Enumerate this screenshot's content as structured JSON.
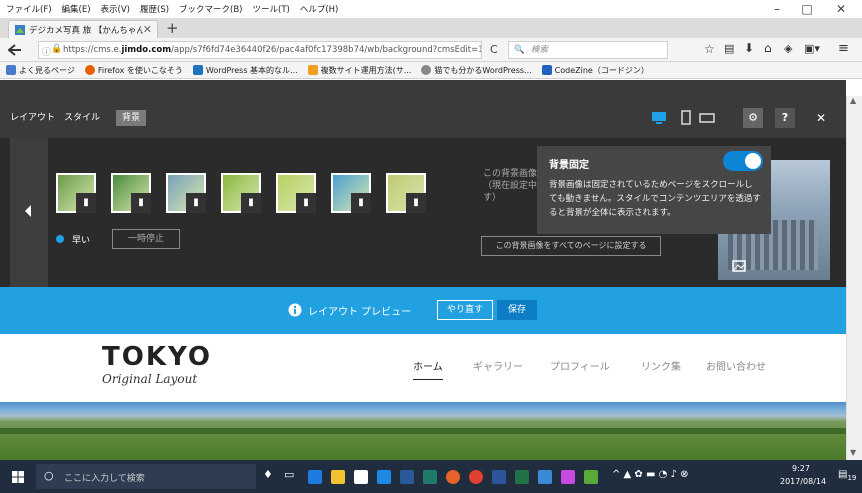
{
  "browser": {
    "menu": [
      "ファイル(F)",
      "編集(E)",
      "表示(V)",
      "履歴(S)",
      "ブックマーク(B)",
      "ツール(T)",
      "ヘルプ(H)"
    ],
    "window_controls": {
      "minimize": "–",
      "maximize": "□",
      "close": "✕"
    },
    "tab": {
      "title": "デジカメ写真 旅 【かんちゃん",
      "close": "✕"
    },
    "new_tab": "+",
    "url_host": "https://cms.e.",
    "url_domain": "jimdo.com",
    "url_path": "/app/s7f6fd74e36440f26/pac4af0fc17398b74/wb/background?cmsEdit=1",
    "reload": "C",
    "search_placeholder": "検索",
    "bookmarks": [
      {
        "label": "よく見るページ",
        "color": "#4a7bc8"
      },
      {
        "label": "Firefox を使いこなそう",
        "color": "#e66000"
      },
      {
        "label": "WordPress 基本的なル...",
        "color": "#1e73be"
      },
      {
        "label": "複数サイト運用方法(サ...",
        "color": "#f0a020"
      },
      {
        "label": "猫でも分かるWordPress...",
        "color": "#888888"
      },
      {
        "label": "CodeZine（コードジン）",
        "color": "#2060c0"
      }
    ]
  },
  "jimdo": {
    "tabs": [
      "レイアウト",
      "スタイル",
      "背景"
    ],
    "help": "?",
    "close": "✕",
    "speed_label": "早い",
    "pause_button": "一時停止",
    "description_line1": "この背景画像",
    "description_line2": "（現在設定中",
    "description_line3": "す）",
    "apply_all_button": "この背景画像をすべてのページに設定する",
    "popup": {
      "title": "背景固定",
      "text_lines": [
        "背景画像は固定されているためページをスクロールし",
        "ても動きません。スタイルでコンテンツエリアを透過す",
        "ると背景が全体に表示されます。"
      ],
      "toggle_on": true
    },
    "preview_label": "レイアウト プレビュー",
    "undo_button": "やり直す",
    "save_button": "保存",
    "thumbnails": [
      "#6a9a4a",
      "#4a8a3c",
      "#7aa0b8",
      "#8ab840",
      "#b8d060",
      "#4aa0d0",
      "#c0c870"
    ]
  },
  "site": {
    "logo_main": "TOKYO",
    "logo_sub": "Original Layout",
    "nav": [
      "ホーム",
      "ギャラリー",
      "プロフィール",
      "リンク集",
      "お問い合わせ"
    ]
  },
  "taskbar": {
    "search_placeholder": "ここに入力して検索",
    "time": "9:27",
    "date": "2017/08/14",
    "notification": "19"
  },
  "colors": {
    "jimdo_blue": "#22a1e1",
    "toggle_blue": "#0d84d4",
    "dark_panel": "#2b2b2b"
  }
}
